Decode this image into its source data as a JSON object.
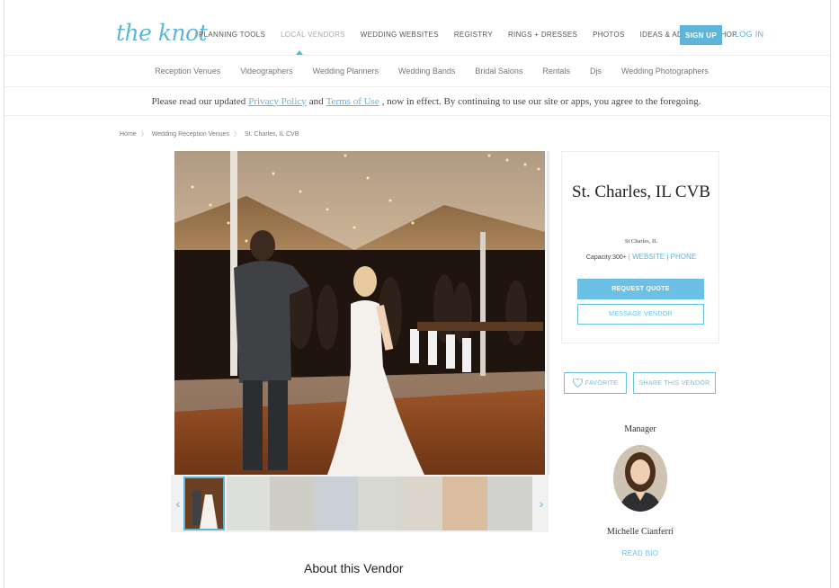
{
  "header": {
    "logo": "the knot",
    "nav": [
      {
        "label": "PLANNING TOOLS",
        "active": false
      },
      {
        "label": "LOCAL VENDORS",
        "active": true
      },
      {
        "label": "WEDDING WEBSITES",
        "active": false
      },
      {
        "label": "REGISTRY",
        "active": false
      },
      {
        "label": "RINGS + DRESSES",
        "active": false
      },
      {
        "label": "PHOTOS",
        "active": false
      },
      {
        "label": "IDEAS & ADVICE",
        "active": false
      },
      {
        "label": "SHOP",
        "active": false
      }
    ],
    "signup_label": "SIGN UP",
    "login_label": "LOG IN"
  },
  "subnav": [
    "Reception Venues",
    "Videographers",
    "Wedding Planners",
    "Wedding Bands",
    "Bridal Salons",
    "Rentals",
    "Djs",
    "Wedding Photographers"
  ],
  "notice": {
    "prefix": "Please read our updated",
    "privacy_link": "Privacy Policy",
    "and": "and",
    "terms_link": "Terms of Use",
    "suffix": ", now in effect. By continuing to use our site or apps, you agree to the foregoing."
  },
  "breadcrumb": [
    "Home",
    "Wedding Reception Venues",
    "St. Charles, IL CVB"
  ],
  "breadcrumb_sep": "〉",
  "vendor": {
    "title": "St. Charles, IL CVB",
    "location": "St Charles, IL",
    "capacity_label": "Capacity:",
    "capacity_value": "300+",
    "website_label": "WEBSITE",
    "phone_label": "PHONE",
    "request_quote": "REQUEST QUOTE",
    "message_vendor": "MESSAGE VENDOR",
    "favorite": "FAVORITE",
    "share": "SHARE THIS VENDOR"
  },
  "manager": {
    "label": "Manager",
    "name": "Michelle Cianferri",
    "read_bio": "READ BIO"
  },
  "about_title": "About this Vendor",
  "colors": {
    "brand": "#5fb5d9",
    "button": "#6cc0e6"
  }
}
